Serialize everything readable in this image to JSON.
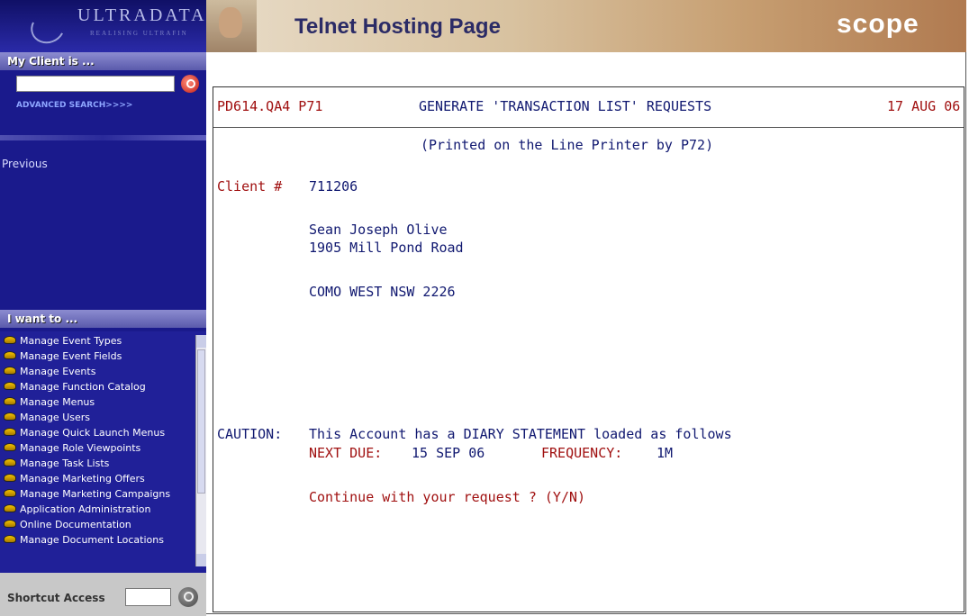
{
  "sidebar": {
    "logo_text": "ULTRADATA",
    "logo_tagline": "REALISING ULTRAFIN",
    "client_section_title": "My Client is ...",
    "client_search_value": "",
    "advanced_search_label": "ADVANCED SEARCH>>>>",
    "previous_label": "Previous",
    "i_want_to_title": "I want to ...",
    "menu_items": [
      "Manage Event Types",
      "Manage Event Fields",
      "Manage Events",
      "Manage Function Catalog",
      "Manage Menus",
      "Manage Users",
      "Manage Quick Launch Menus",
      "Manage Role Viewpoints",
      "Manage Task Lists",
      "Manage Marketing Offers",
      "Manage Marketing Campaigns",
      "Application Administration",
      "Online Documentation",
      "Manage Document Locations"
    ],
    "shortcut_label": "Shortcut Access",
    "shortcut_value": ""
  },
  "header": {
    "title": "Telnet Hosting Page",
    "brand": "scope"
  },
  "terminal": {
    "screen_id": "PD614.QA4 P71",
    "screen_title": "GENERATE 'TRANSACTION LIST' REQUESTS",
    "date": "17 AUG 06",
    "subtitle": "(Printed on the Line Printer by P72)",
    "client_label": "Client #",
    "client_number": "711206",
    "address": [
      "Sean Joseph Olive",
      "1905 Mill Pond Road",
      "COMO WEST NSW 2226"
    ],
    "caution_label": "CAUTION:",
    "caution_text": "This Account has a DIARY STATEMENT loaded as follows",
    "next_due_label": "NEXT DUE:",
    "next_due_value": "15 SEP 06",
    "frequency_label": "FREQUENCY:",
    "frequency_value": "1M",
    "prompt": "Continue with your request ? (Y/N)"
  },
  "colors": {
    "sidebar_bg": "#1a1a8c",
    "terminal_red": "#a01010",
    "terminal_blue": "#101870"
  }
}
